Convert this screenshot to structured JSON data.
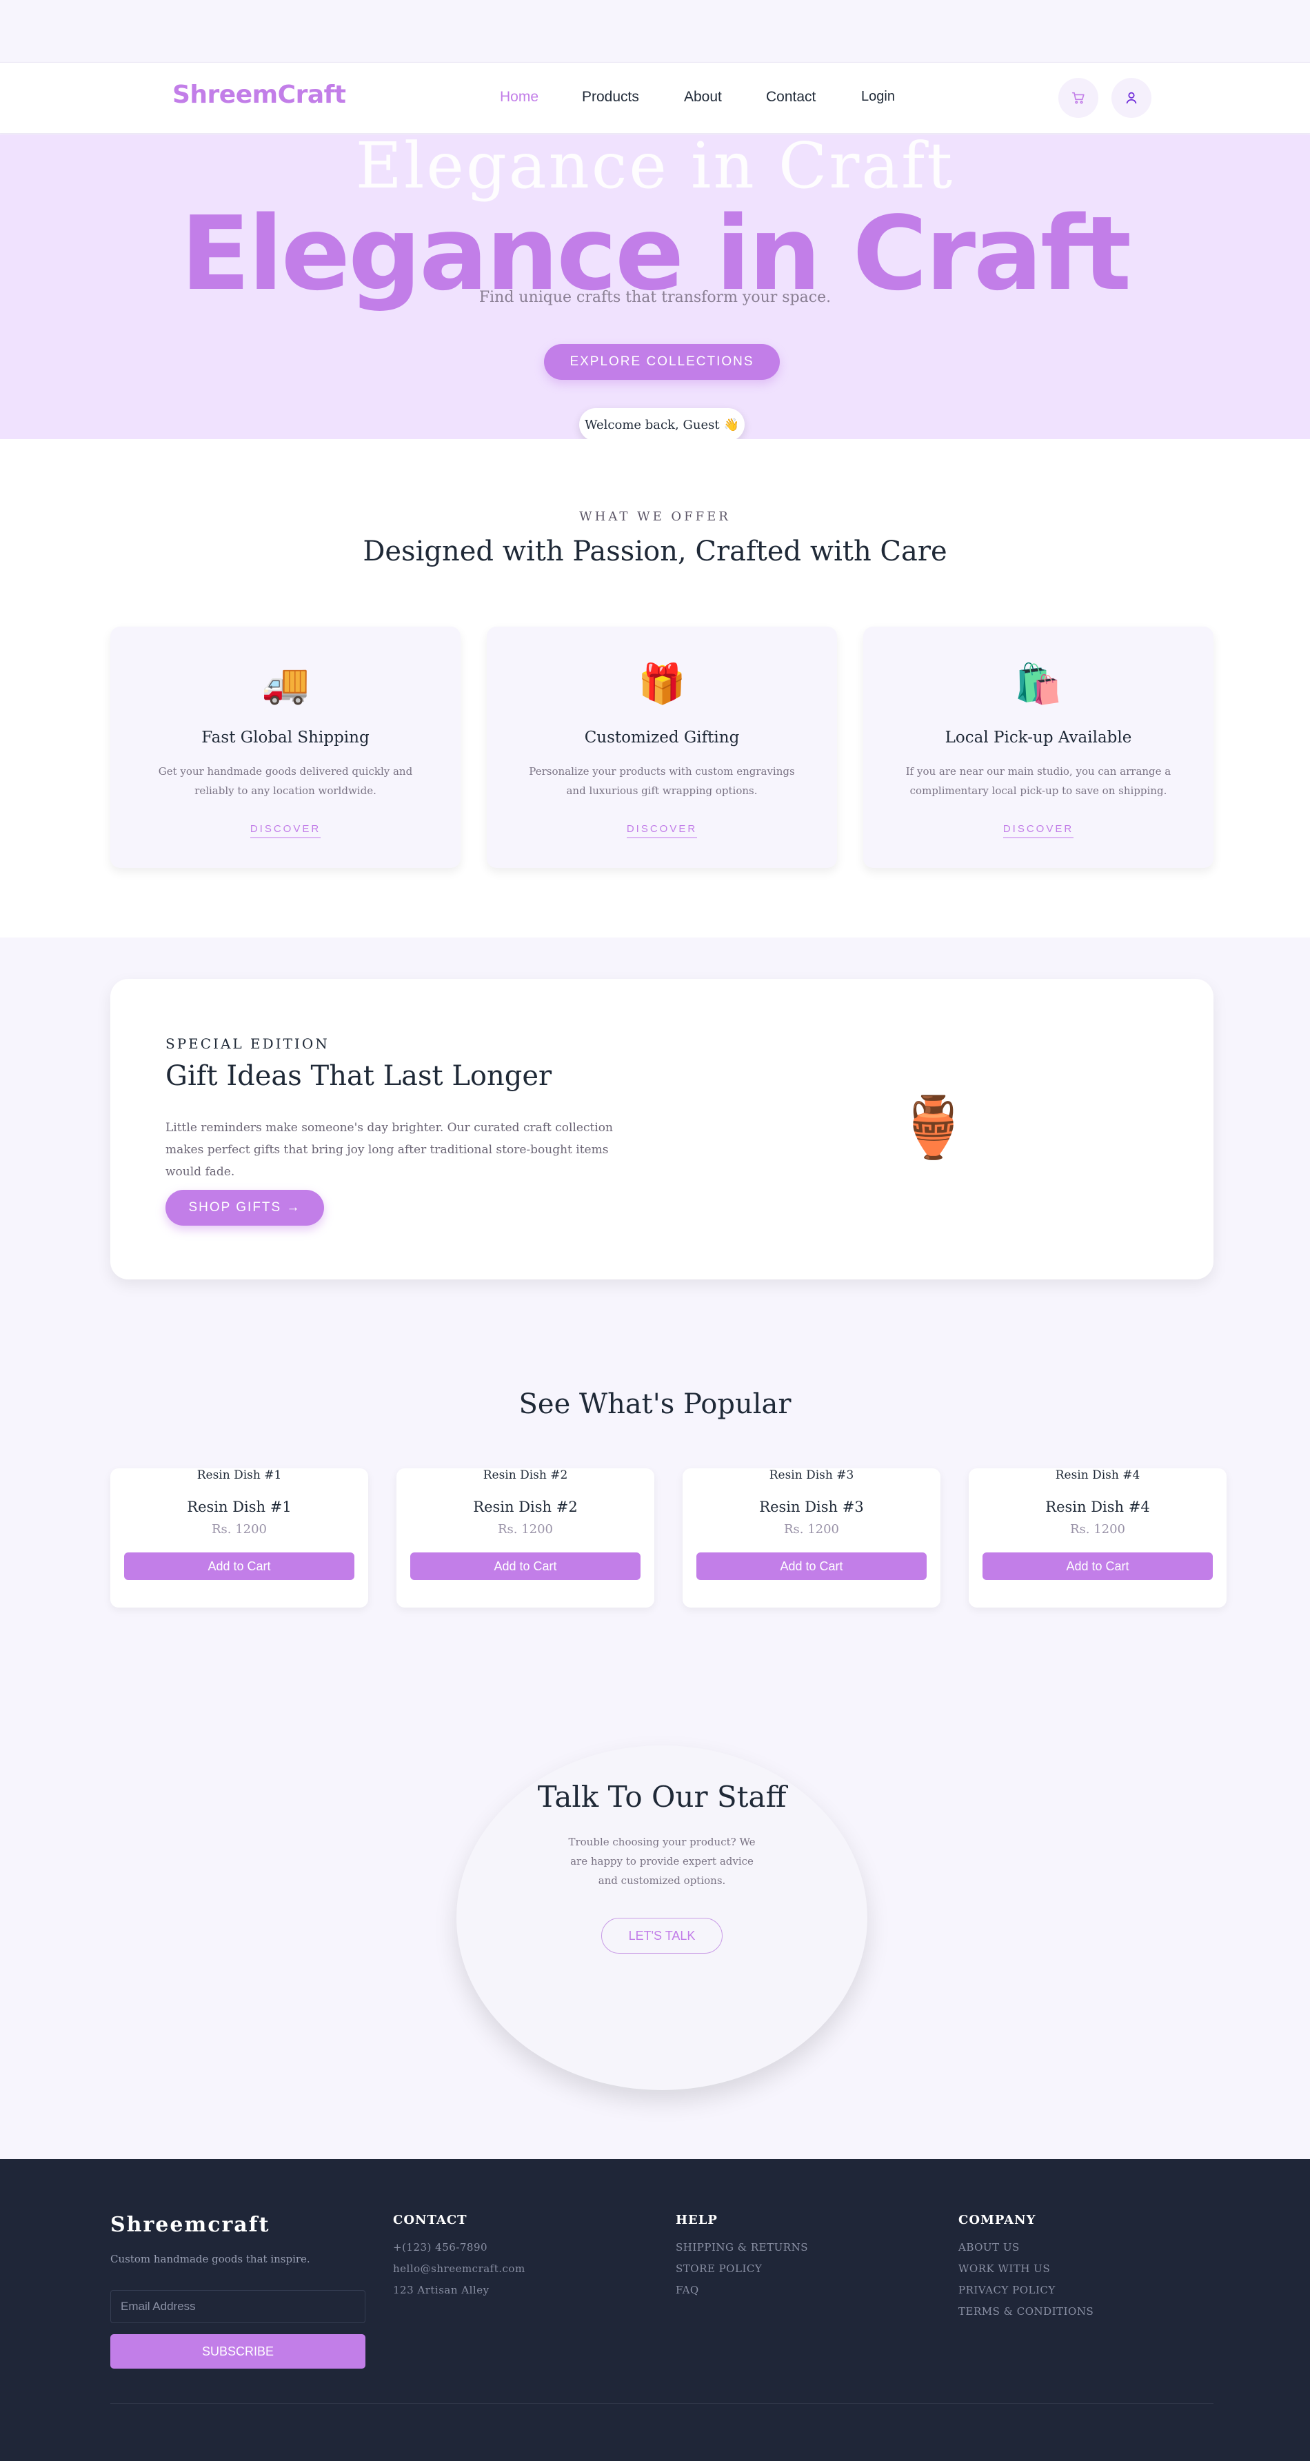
{
  "header": {
    "logo": "ShreemCraft",
    "nav": [
      {
        "label": "Home",
        "active": true
      },
      {
        "label": "Products",
        "active": false
      },
      {
        "label": "About",
        "active": false
      },
      {
        "label": "Contact",
        "active": false
      },
      {
        "label": "Login",
        "active": false
      }
    ],
    "icons": [
      "cart-icon",
      "user-icon"
    ]
  },
  "hero": {
    "ghost_title": "Elegance in Craft",
    "title": "Elegance in Craft",
    "subtitle": "Find unique crafts that transform your space.",
    "cta_label": "EXPLORE COLLECTIONS",
    "welcome": "Welcome back, Guest",
    "welcome_emoji": "👋"
  },
  "offer": {
    "eyebrow": "WHAT WE OFFER",
    "title": "Designed with Passion, Crafted with Care",
    "cards": [
      {
        "emoji": "🚚",
        "title": "Fast Global Shipping",
        "text": "Get your handmade goods delivered quickly and reliably to any location worldwide.",
        "link": "DISCOVER"
      },
      {
        "emoji": "🎁",
        "title": "Customized Gifting",
        "text": "Personalize your products with custom engravings and luxurious gift wrapping options.",
        "link": "DISCOVER"
      },
      {
        "emoji": "🛍️",
        "title": "Local Pick-up Available",
        "text": "If you are near our main studio, you can arrange a complimentary local pick-up to save on shipping.",
        "link": "DISCOVER"
      }
    ]
  },
  "special": {
    "eyebrow": "SPECIAL EDITION",
    "title": "Gift Ideas That Last Longer",
    "text": "Little reminders make someone's day brighter. Our curated craft collection makes perfect gifts that bring joy long after traditional store-bought items would fade.",
    "cta_label": "SHOP GIFTS →",
    "image_emoji": "🏺"
  },
  "popular": {
    "title": "See What's Popular",
    "products": [
      {
        "img_alt": "Resin Dish #1",
        "name": "Resin Dish #1",
        "price": "Rs. 1200",
        "button": "Add to Cart"
      },
      {
        "img_alt": "Resin Dish #2",
        "name": "Resin Dish #2",
        "price": "Rs. 1200",
        "button": "Add to Cart"
      },
      {
        "img_alt": "Resin Dish #3",
        "name": "Resin Dish #3",
        "price": "Rs. 1200",
        "button": "Add to Cart"
      },
      {
        "img_alt": "Resin Dish #4",
        "name": "Resin Dish #4",
        "price": "Rs. 1200",
        "button": "Add to Cart"
      }
    ]
  },
  "talk": {
    "title": "Talk To Our Staff",
    "text": "Trouble choosing your product? We are happy to provide expert advice and customized options.",
    "cta_label": "LET'S TALK"
  },
  "footer": {
    "brand": "Shreemcraft",
    "tagline": "Custom handmade goods that inspire.",
    "email_placeholder": "Email Address",
    "subscribe_label": "SUBSCRIBE",
    "columns": [
      {
        "heading": "CONTACT",
        "items": [
          "+(123) 456-7890",
          "hello@shreemcraft.com",
          "123 Artisan Alley"
        ]
      },
      {
        "heading": "HELP",
        "items": [
          "SHIPPING & RETURNS",
          "STORE POLICY",
          "FAQ"
        ]
      },
      {
        "heading": "COMPANY",
        "items": [
          "ABOUT US",
          "WORK WITH US",
          "PRIVACY POLICY",
          "TERMS & CONDITIONS"
        ]
      }
    ]
  },
  "colors": {
    "accent": "#c27ee8",
    "hero_bg": "#f0e2fe",
    "page_bg": "#f7f5fd",
    "footer_bg": "#1f2638",
    "text_dark": "#1f2937"
  }
}
